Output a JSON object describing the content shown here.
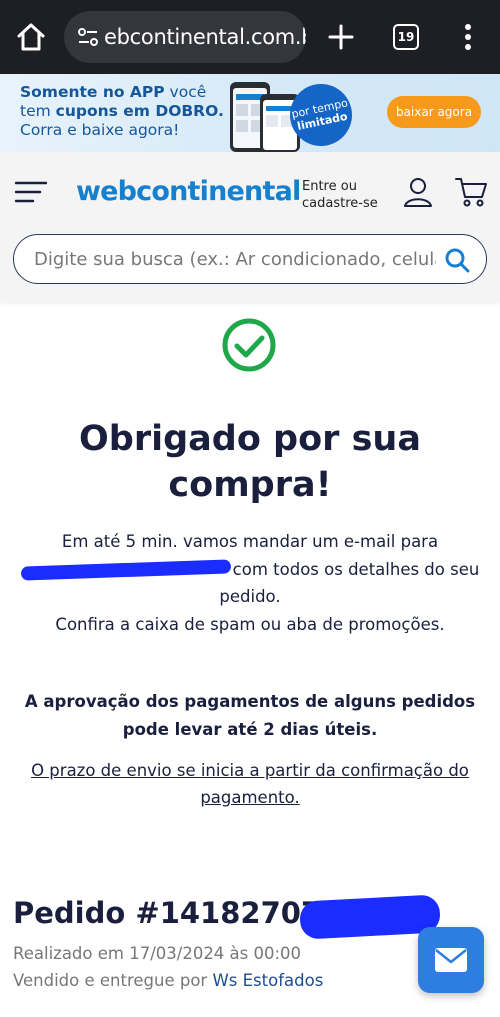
{
  "browser": {
    "url": "ebcontinental.com.br",
    "tab_count": "19",
    "icons": [
      "home-icon",
      "site-settings-icon",
      "plus-icon",
      "tabs-icon",
      "more-vert-icon"
    ]
  },
  "promo": {
    "line1_bold": "Somente no APP",
    "line1_rest": " você",
    "line2_pre": "tem ",
    "line2_bold": "cupons em DOBRO.",
    "line3": "Corra e baixe agora!",
    "badge_line1": "por tempo",
    "badge_line2": "limitado",
    "button_label": "baixar agora",
    "colors": {
      "text": "#14579b",
      "badge": "#1465c6",
      "button": "#f79a1c"
    }
  },
  "header": {
    "logo_text": "webcontinental",
    "login_line1": "Entre ou",
    "login_line2": "cadastre-se",
    "search_placeholder": "Digite sua busca (ex.: Ar condicionado, celular...)",
    "brand_color": "#1580d0"
  },
  "confirmation": {
    "title_line1": "Obrigado por sua",
    "title_line2": "compra!",
    "info_line1": "Em até 5 min. vamos mandar um e-mail para",
    "info_line2_after_email": "com todos os detalhes do seu",
    "info_line3": "pedido.",
    "info_line4": "Confira a caixa de spam ou aba de promoções.",
    "approval_line1": "A aprovação dos pagamentos de alguns pedidos",
    "approval_line2": "pode levar até 2 dias úteis.",
    "shipping_note": "O prazo de envio se inicia a partir da confirmação do pagamento.",
    "success_color": "#1fa84a"
  },
  "order": {
    "number_label": "Pedido #14182707",
    "date_text": "Realizado em 17/03/2024 às 00:00",
    "seller_prefix": "Vendido e entregue por ",
    "seller_name": "Ws Estofados"
  },
  "contact_fab": {
    "icon": "envelope-icon",
    "color": "#2e7de1"
  }
}
